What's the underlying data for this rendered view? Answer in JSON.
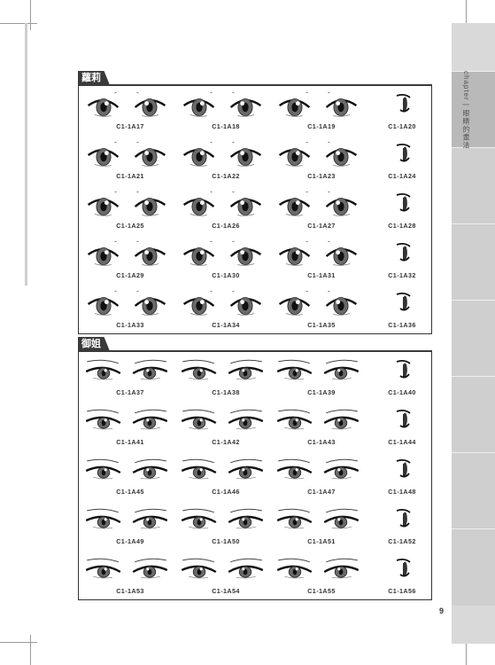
{
  "side_tab": {
    "chapter_label": "chapter",
    "title": "眼睛的畫法"
  },
  "sections": [
    {
      "label": "蘿莉",
      "rows": [
        [
          "C1-1A17",
          "C1-1A18",
          "C1-1A19",
          "C1-1A20"
        ],
        [
          "C1-1A21",
          "C1-1A22",
          "C1-1A23",
          "C1-1A24"
        ],
        [
          "C1-1A25",
          "C1-1A26",
          "C1-1A27",
          "C1-1A28"
        ],
        [
          "C1-1A29",
          "C1-1A30",
          "C1-1A31",
          "C1-1A32"
        ],
        [
          "C1-1A33",
          "C1-1A34",
          "C1-1A35",
          "C1-1A36"
        ]
      ]
    },
    {
      "label": "御姐",
      "rows": [
        [
          "C1-1A37",
          "C1-1A38",
          "C1-1A39",
          "C1-1A40"
        ],
        [
          "C1-1A41",
          "C1-1A42",
          "C1-1A43",
          "C1-1A44"
        ],
        [
          "C1-1A45",
          "C1-1A46",
          "C1-1A47",
          "C1-1A48"
        ],
        [
          "C1-1A49",
          "C1-1A50",
          "C1-1A51",
          "C1-1A52"
        ],
        [
          "C1-1A53",
          "C1-1A54",
          "C1-1A55",
          "C1-1A56"
        ]
      ]
    }
  ],
  "page_number": "9"
}
